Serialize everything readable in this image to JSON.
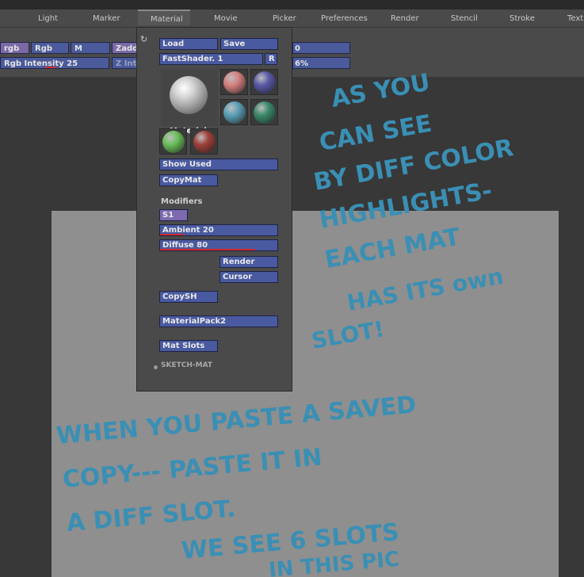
{
  "menu": {
    "items": [
      "Light",
      "Marker",
      "Material",
      "Movie",
      "Picker",
      "Preferences",
      "Render",
      "Stencil",
      "Stroke",
      "Text"
    ],
    "active": "Material"
  },
  "toolbar": {
    "rgb_mode": "rgb",
    "rgb_button": "Rgb",
    "m_button": "M",
    "zadd_button": "Zadd",
    "rgb_intensity_label": "Rgb Intensity",
    "rgb_intensity_value": "25",
    "rgb_intensity_fraction": 0.25,
    "z_intensity_label": "Z Inter",
    "right_value_1": "0",
    "right_value_2": "6%"
  },
  "material_panel": {
    "load_label": "Load",
    "save_label": "Save",
    "current_material": "FastShader. 1",
    "r_button": "R",
    "material_dropdown_label": "Material",
    "show_used_label": "Show Used",
    "copymat_label": "CopyMat",
    "modifiers_heading": "Modifiers",
    "s1_label": "S1",
    "ambient_label": "Ambient",
    "ambient_value": "20",
    "ambient_fraction": 0.2,
    "diffuse_label": "Diffuse",
    "diffuse_value": "80",
    "diffuse_fraction": 0.8,
    "render_label": "Render",
    "cursor_label": "Cursor",
    "copysh_label": "CopySH",
    "materialpack_label": "MaterialPack2",
    "matslots_label": "Mat Slots",
    "sketch_mat_label": "SKETCH-MAT",
    "swatch_colors": [
      "#d88080",
      "#5a5aa8",
      "#5aa0b8",
      "#3a8a6a",
      "#6ac05a",
      "#a0403a"
    ]
  },
  "annotations": {
    "color": "#3a8fb4",
    "note_1": [
      "AS YOU",
      "CAN SEE",
      "BY DIFF COLOR",
      "HIGHLIGHTS-",
      "EACH MAT",
      "HAS ITS own",
      "SLOT!"
    ],
    "note_2": [
      "WHEN YOU PASTE A SAVED",
      "COPY--- PASTE IT IN",
      "A DIFF SLOT.",
      "WE SEE 6 SLOTS",
      "IN THIS PIC"
    ]
  }
}
